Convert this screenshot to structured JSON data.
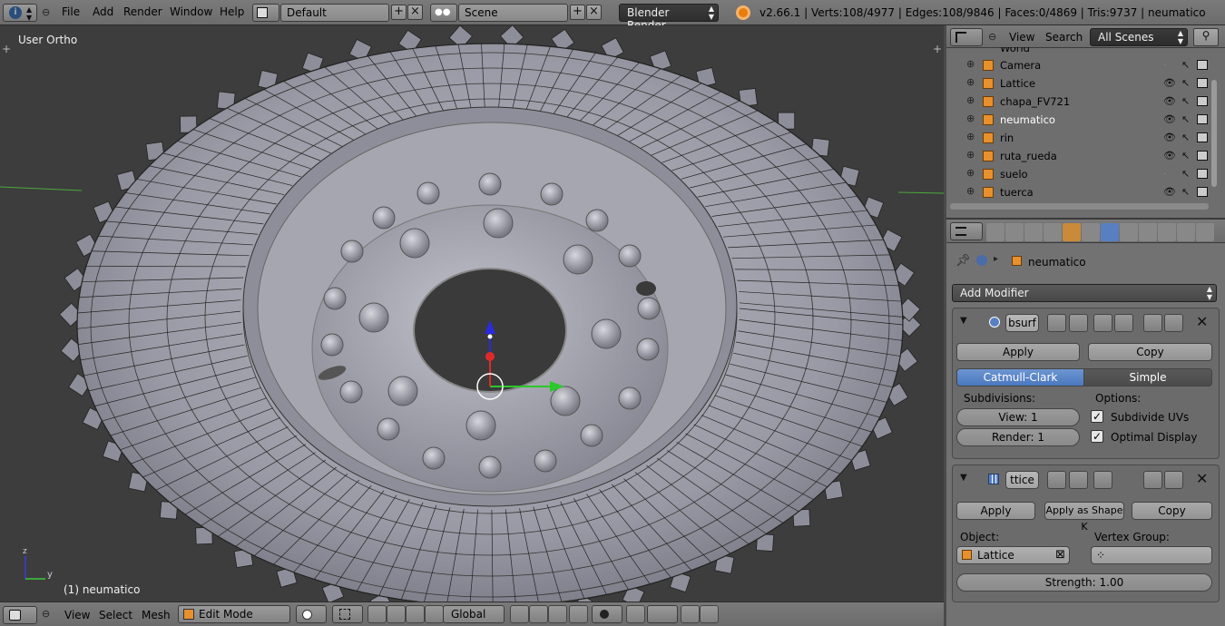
{
  "topbar": {
    "menus": [
      "File",
      "Add",
      "Render",
      "Window",
      "Help"
    ],
    "layout": "Default",
    "scene": "Scene",
    "engine": "Blender Render",
    "stats": "v2.66.1 | Verts:108/4977 | Edges:108/9846 | Faces:0/4869 | Tris:9737 | neumatico"
  },
  "viewport": {
    "view_label": "User Ortho",
    "object_label": "(1) neumatico",
    "axis_x": "y",
    "axis_z": "z"
  },
  "view3d_header": {
    "menus": [
      "View",
      "Select",
      "Mesh"
    ],
    "mode": "Edit Mode",
    "orientation": "Global"
  },
  "outliner": {
    "menus": [
      "View",
      "Search"
    ],
    "display": "All Scenes",
    "top_partial": "World",
    "items": [
      {
        "name": "Camera",
        "icon": "camera-icon",
        "visible": false
      },
      {
        "name": "Lattice",
        "icon": "lattice-icon",
        "visible": true
      },
      {
        "name": "chapa_FV721",
        "icon": "mesh-icon",
        "visible": true
      },
      {
        "name": "neumatico",
        "icon": "mesh-icon",
        "visible": true,
        "selected": true
      },
      {
        "name": "rin",
        "icon": "mesh-icon",
        "visible": true
      },
      {
        "name": "ruta_rueda",
        "icon": "curve-icon",
        "visible": true
      },
      {
        "name": "suelo",
        "icon": "mesh-icon",
        "visible": false
      },
      {
        "name": "tuerca",
        "icon": "mesh-icon",
        "visible": true
      }
    ]
  },
  "properties": {
    "breadcrumb": "neumatico",
    "add_modifier": "Add Modifier",
    "subsurf": {
      "name": "bsurf",
      "apply": "Apply",
      "copy": "Copy",
      "algo_catmull": "Catmull-Clark",
      "algo_simple": "Simple",
      "subdivisions_label": "Subdivisions:",
      "options_label": "Options:",
      "view": "View: 1",
      "render": "Render: 1",
      "subdivide_uvs": "Subdivide UVs",
      "optimal_display": "Optimal Display"
    },
    "lattice_mod": {
      "name": "ttice",
      "apply": "Apply",
      "apply_shape": "Apply as Shape K",
      "copy": "Copy",
      "object_label": "Object:",
      "vertex_group_label": "Vertex Group:",
      "object_value": "Lattice",
      "strength": "Strength: 1.00"
    }
  },
  "colors": {
    "accent_blue": "#5680c2",
    "header_gray": "#727272",
    "viewport_bg": "#3d3d3d",
    "orange_icon": "#e8902c"
  }
}
